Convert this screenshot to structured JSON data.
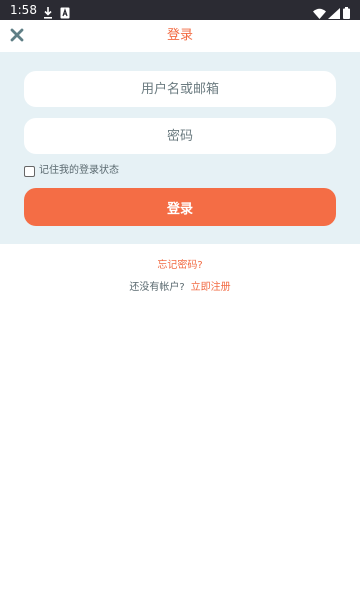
{
  "status_bar": {
    "time": "1:58",
    "icons": [
      "download-icon",
      "a-icon",
      "wifi-icon",
      "signal-icon",
      "battery-icon"
    ]
  },
  "header": {
    "title": "登录",
    "close_icon": "close-icon"
  },
  "form": {
    "username_placeholder": "用户名或邮箱",
    "username_value": "",
    "password_placeholder": "密码",
    "password_value": "",
    "remember_label": "记住我的登录状态",
    "remember_checked": false,
    "login_label": "登录"
  },
  "links": {
    "forgot_password": "忘记密码?",
    "no_account": "还没有帐户?",
    "register": "立即注册"
  },
  "colors": {
    "accent": "#f46d45",
    "panel_background": "#e6f1f5",
    "close_icon": "#5f7f86",
    "status_bar": "#2b2b33"
  }
}
